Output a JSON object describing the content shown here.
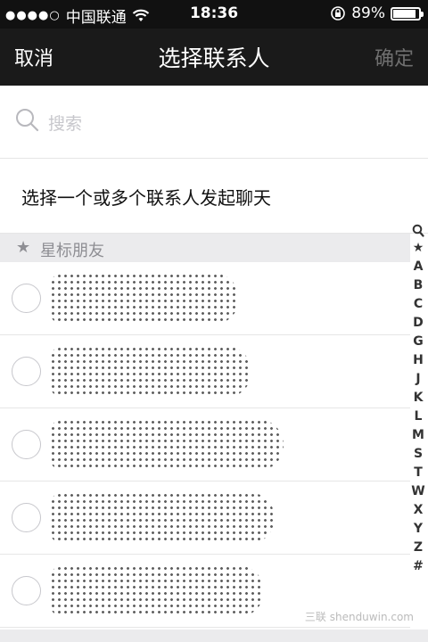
{
  "status_bar": {
    "signal_dots": "●●●●○",
    "carrier": "中国联通",
    "time": "18:36",
    "battery_percent": "89%",
    "battery_level": 0.89
  },
  "nav": {
    "cancel": "取消",
    "title": "选择联系人",
    "confirm": "确定"
  },
  "search": {
    "placeholder": "搜索"
  },
  "prompt": "选择一个或多个联系人发起聊天",
  "section": {
    "star": "★",
    "title": "星标朋友"
  },
  "index_bar": [
    "★",
    "A",
    "B",
    "C",
    "D",
    "G",
    "H",
    "J",
    "K",
    "L",
    "M",
    "S",
    "T",
    "W",
    "X",
    "Y",
    "Z",
    "#"
  ],
  "watermark": "三联 shenduwin.com",
  "colors": {
    "nav_bg": "#1a1a1a",
    "status_bg": "#111111",
    "section_bg": "#ebebed",
    "confirm_disabled": "#6f6f6f"
  }
}
